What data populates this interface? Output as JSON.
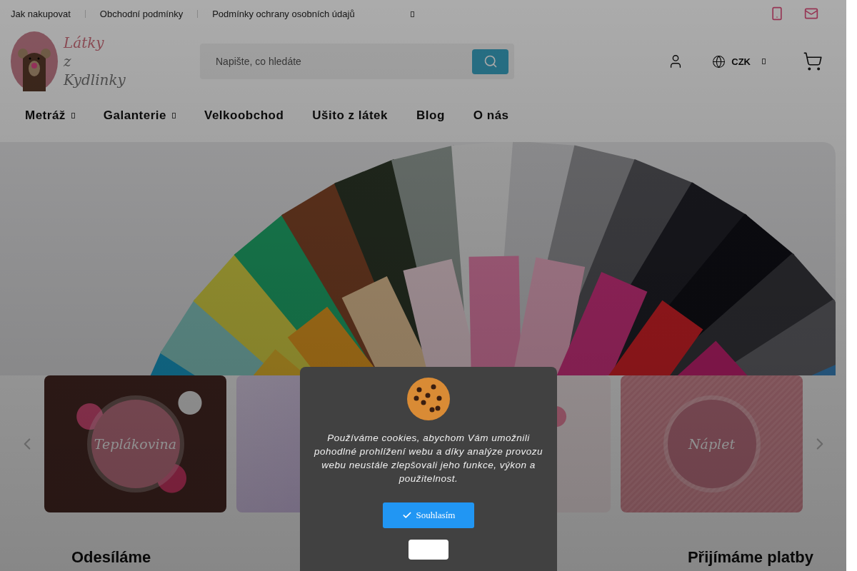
{
  "top_links": [
    "Jak nakupovat",
    "Obchodní podmínky",
    "Podmínky ochrany osobních údajů"
  ],
  "logo": {
    "lines": [
      "Látky",
      "z",
      "Kydlinky"
    ]
  },
  "search": {
    "placeholder": "Napište, co hledáte"
  },
  "currency": "CZK",
  "nav": [
    {
      "label": "Metráž",
      "dropdown": true
    },
    {
      "label": "Galanterie",
      "dropdown": true
    },
    {
      "label": "Velkoobchod",
      "dropdown": false
    },
    {
      "label": "Ušito z látek",
      "dropdown": false
    },
    {
      "label": "Blog",
      "dropdown": false
    },
    {
      "label": "O nás",
      "dropdown": false
    }
  ],
  "cards": [
    {
      "kind": "hedgehog",
      "label": "Teplákovina"
    },
    {
      "kind": "lilac"
    },
    {
      "kind": "flamingo"
    },
    {
      "kind": "rib",
      "label": "Náplet"
    }
  ],
  "sections": [
    "Odesíláme",
    "Přijímáme platby"
  ],
  "cookie_dialog": {
    "text": "Používáme cookies, abychom Vám umožnili pohodlné prohlížení webu a díky analýze provozu webu neustále zlepšovali jeho funkce, výkon a použitelnost.",
    "accept": "Souhlasím"
  }
}
